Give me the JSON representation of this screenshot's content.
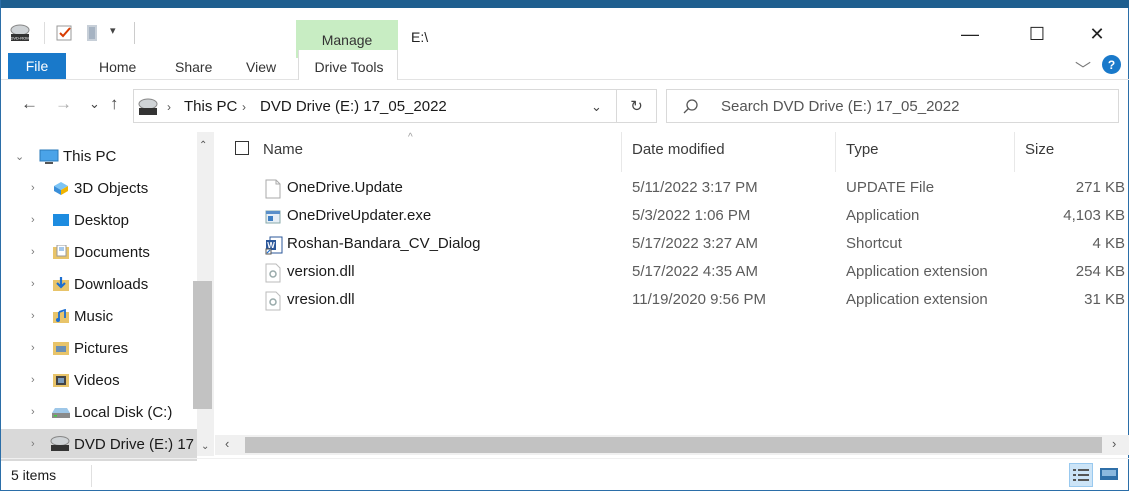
{
  "window": {
    "title": "E:\\",
    "manage_label": "Manage",
    "minimize_glyph": "—",
    "maximize_glyph": "☐",
    "close_glyph": "✕"
  },
  "ribbon": {
    "tabs": [
      "File",
      "Home",
      "Share",
      "View",
      "Drive Tools"
    ],
    "help_glyph": "?"
  },
  "nav": {
    "back_glyph": "←",
    "forward_glyph": "→",
    "recent_glyph": "⌄",
    "up_glyph": "↑",
    "breadcrumb": [
      "This PC",
      "DVD Drive (E:) 17_05_2022"
    ],
    "dropdown_glyph": "⌄",
    "refresh_glyph": "↻",
    "search_placeholder": "Search DVD Drive (E:) 17_05_2022"
  },
  "tree": {
    "root": "This PC",
    "items": [
      {
        "label": "3D Objects",
        "icon": "3d-objects-icon"
      },
      {
        "label": "Desktop",
        "icon": "desktop-folder-icon"
      },
      {
        "label": "Documents",
        "icon": "documents-folder-icon"
      },
      {
        "label": "Downloads",
        "icon": "downloads-folder-icon"
      },
      {
        "label": "Music",
        "icon": "music-folder-icon"
      },
      {
        "label": "Pictures",
        "icon": "pictures-folder-icon"
      },
      {
        "label": "Videos",
        "icon": "videos-folder-icon"
      },
      {
        "label": "Local Disk (C:)",
        "icon": "local-disk-icon"
      },
      {
        "label": "DVD Drive (E:) 17",
        "icon": "dvd-drive-icon"
      }
    ]
  },
  "columns": [
    "Name",
    "Date modified",
    "Type",
    "Size"
  ],
  "files": [
    {
      "name": "OneDrive.Update",
      "date": "5/11/2022 3:17 PM",
      "type": "UPDATE File",
      "size": "271 KB",
      "icon": "blank-file-icon"
    },
    {
      "name": "OneDriveUpdater.exe",
      "date": "5/3/2022 1:06 PM",
      "type": "Application",
      "size": "4,103 KB",
      "icon": "exe-file-icon"
    },
    {
      "name": "Roshan-Bandara_CV_Dialog",
      "date": "5/17/2022 3:27 AM",
      "type": "Shortcut",
      "size": "4 KB",
      "icon": "word-shortcut-icon"
    },
    {
      "name": "version.dll",
      "date": "5/17/2022 4:35 AM",
      "type": "Application extension",
      "size": "254 KB",
      "icon": "dll-file-icon"
    },
    {
      "name": "vresion.dll",
      "date": "11/19/2020 9:56 PM",
      "type": "Application extension",
      "size": "31 KB",
      "icon": "dll-file-icon"
    }
  ],
  "status": {
    "count_text": "5 items"
  },
  "colors": {
    "accent": "#1979ca",
    "manage_tab": "#c8edc3",
    "selected_tree": "#d9d9d9"
  }
}
